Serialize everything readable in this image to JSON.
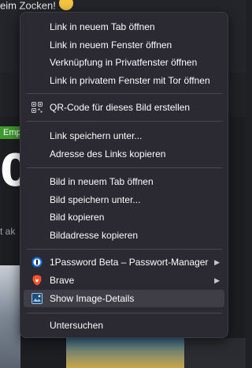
{
  "background": {
    "top_text": "eim Zocken!",
    "tag_label": "Emp",
    "big_glyph": "0",
    "side_text": "t ak"
  },
  "context_menu": {
    "items": [
      {
        "label": "Link in neuem Tab öffnen"
      },
      {
        "label": "Link in neuem Fenster öffnen"
      },
      {
        "label": "Verknüpfung in Privatfenster öffnen"
      },
      {
        "label": "Link in privatem Fenster mit Tor öffnen"
      },
      {
        "label": "QR-Code für dieses Bild erstellen",
        "icon": "qr-code-icon"
      },
      {
        "label": "Link speichern unter..."
      },
      {
        "label": "Adresse des Links kopieren"
      },
      {
        "label": "Bild in neuem Tab öffnen"
      },
      {
        "label": "Bild speichern unter..."
      },
      {
        "label": "Bild kopieren"
      },
      {
        "label": "Bildadresse kopieren"
      },
      {
        "label": "1Password Beta – Passwort-Manager",
        "icon": "1password-icon",
        "submenu": true
      },
      {
        "label": "Brave",
        "icon": "brave-lion-icon",
        "submenu": true
      },
      {
        "label": "Show Image-Details",
        "icon": "image-details-icon",
        "highlighted": true
      },
      {
        "label": "Untersuchen"
      }
    ]
  },
  "colors": {
    "menu_bg": "#2b2a33",
    "menu_text": "#fbfbfe",
    "highlight": "#3f3e47",
    "brave_orange": "#fb542b",
    "onepassword_blue": "#0572ec"
  }
}
